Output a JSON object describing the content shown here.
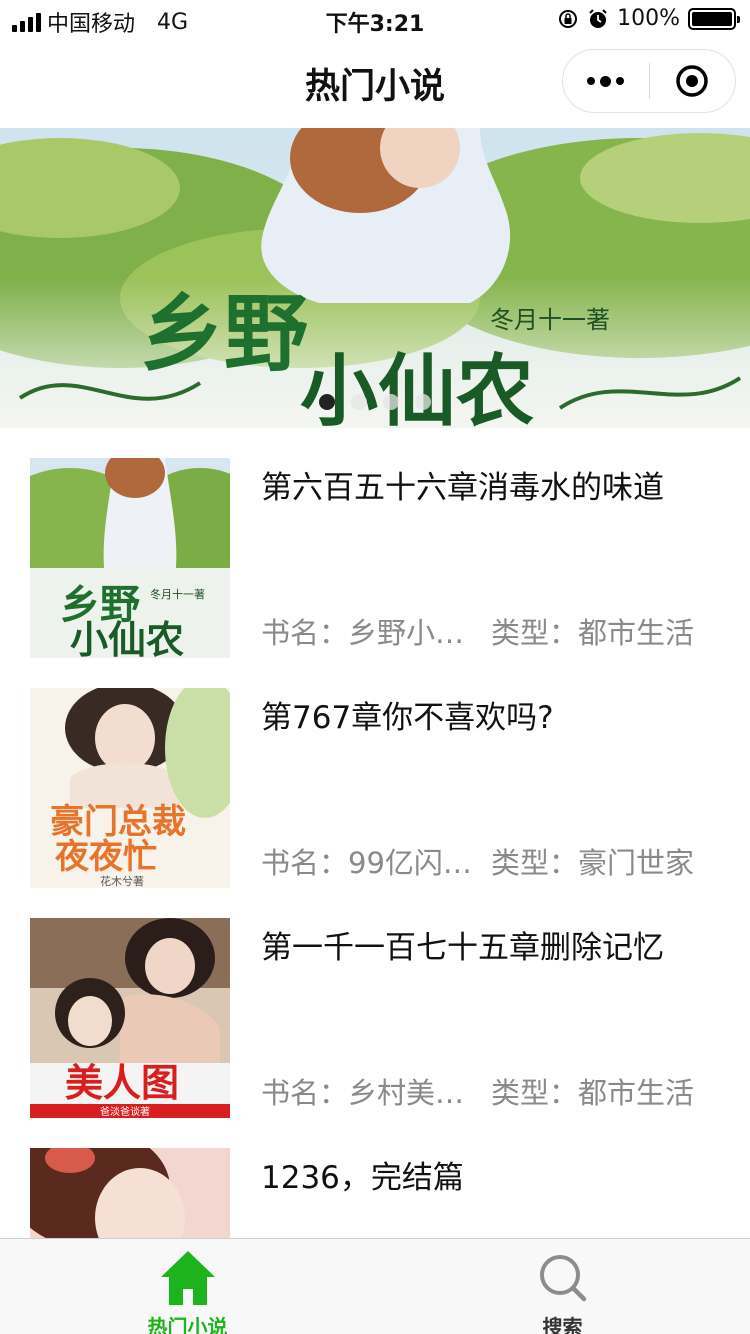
{
  "status_bar": {
    "carrier": "中国移动",
    "network": "4G",
    "time": "下午3:21",
    "battery": "100%",
    "battery_level": 1.0
  },
  "nav": {
    "title": "热门小说"
  },
  "banner": {
    "slide_count": 4,
    "active_index": 0
  },
  "novels": [
    {
      "chapter": "第六百五十六章消毒水的味道",
      "book_label": "书名：乡野小…",
      "type_label": "类型：都市生活"
    },
    {
      "chapter": "第767章你不喜欢吗?",
      "book_label": "书名：99亿闪…",
      "type_label": "类型：豪门世家"
    },
    {
      "chapter": "第一千一百七十五章删除记忆",
      "book_label": "书名：乡村美…",
      "type_label": "类型：都市生活"
    },
    {
      "chapter": "1236，完结篇",
      "book_label": "",
      "type_label": ""
    }
  ],
  "covers": {
    "cover1_title": "乡野小仙农",
    "cover2_title": "豪门总裁夜夜忙",
    "cover3_title": "美人图"
  },
  "tabbar": {
    "home_label": "热门小说",
    "search_label": "搜索",
    "active_color": "#1db31d"
  }
}
